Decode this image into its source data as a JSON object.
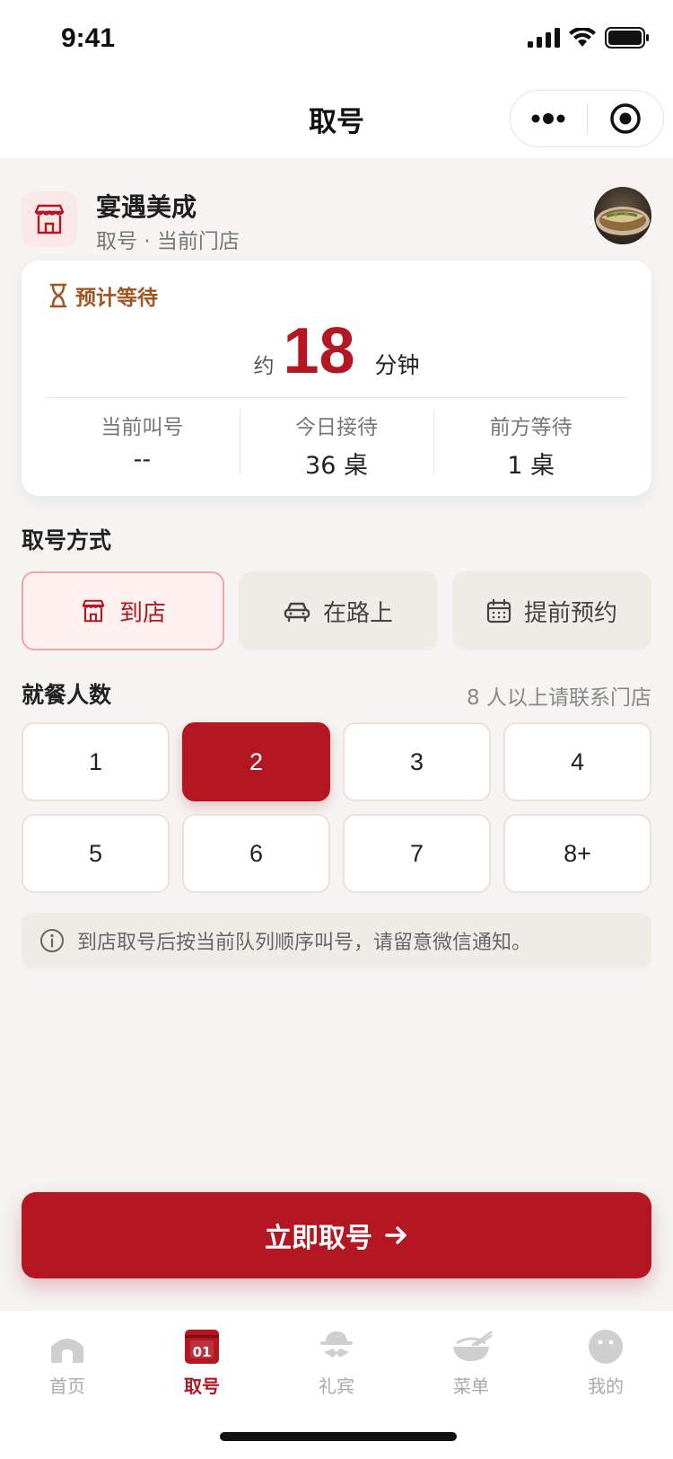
{
  "status_bar": {
    "time": "9:41"
  },
  "nav": {
    "title": "取号"
  },
  "store": {
    "name": "宴遇美成",
    "subtitle": "取号 · 当前门店"
  },
  "wait_card": {
    "label": "预计等待",
    "prefix": "约",
    "minutes": "18",
    "unit": "分钟",
    "stats": [
      {
        "label": "当前叫号",
        "value": "--"
      },
      {
        "label": "今日接待",
        "value": "36 桌"
      },
      {
        "label": "前方等待",
        "value": "1 桌"
      }
    ]
  },
  "mode_section": {
    "title": "取号方式",
    "options": [
      {
        "label": "到店",
        "icon": "store-icon",
        "active": true
      },
      {
        "label": "在路上",
        "icon": "car-icon",
        "active": false
      },
      {
        "label": "提前预约",
        "icon": "calendar-icon",
        "active": false
      }
    ]
  },
  "party_section": {
    "title": "就餐人数",
    "hint": "8 人以上请联系门店",
    "options": [
      "1",
      "2",
      "3",
      "4",
      "5",
      "6",
      "7",
      "8+"
    ],
    "selected": "2"
  },
  "notice": {
    "text": "到店取号后按当前队列顺序叫号，请留意微信通知。"
  },
  "cta": {
    "label": "立即取号"
  },
  "tabbar": {
    "items": [
      {
        "label": "首页",
        "icon": "home-icon",
        "active": false
      },
      {
        "label": "取号",
        "icon": "ticket-icon",
        "badge": "01",
        "active": true
      },
      {
        "label": "礼宾",
        "icon": "concierge-icon",
        "active": false
      },
      {
        "label": "菜单",
        "icon": "bowl-icon",
        "active": false
      },
      {
        "label": "我的",
        "icon": "profile-icon",
        "active": false
      }
    ]
  },
  "colors": {
    "brand": "#b41622",
    "accent": "#a0541f",
    "background": "#f5f4f2"
  }
}
